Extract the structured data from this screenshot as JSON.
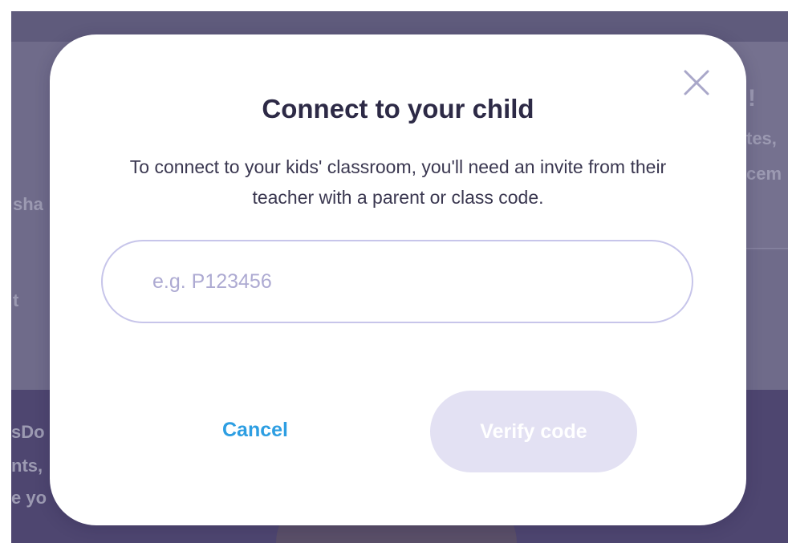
{
  "background": {
    "fragments": [
      "!",
      "tes,",
      "cem",
      "sha",
      "t",
      "sDo",
      "nts,",
      "e yo"
    ]
  },
  "dialog": {
    "title": "Connect to your child",
    "description": "To connect to  your kids' classroom, you'll need an invite from their teacher with a parent or class code.",
    "input": {
      "placeholder": "e.g. P123456",
      "value": ""
    },
    "cancel_label": "Cancel",
    "verify_label": "Verify code",
    "close_icon": "close-icon"
  },
  "colors": {
    "overlay": "#6f6b8a",
    "title_text": "#2d2a46",
    "cancel_blue": "#2d9ee2",
    "verify_disabled_bg": "#e3e1f3",
    "input_border": "#c7c5ea",
    "placeholder": "#adaad2"
  }
}
